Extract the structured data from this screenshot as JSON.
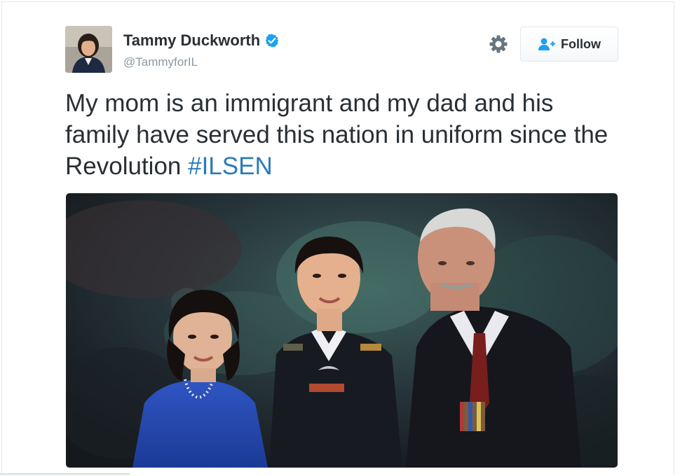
{
  "tweet": {
    "author": {
      "name": "Tammy Duckworth",
      "handle": "@TammyforIL",
      "verified": true,
      "verified_icon": "verified-badge-icon",
      "avatar_icon": "profile-avatar"
    },
    "actions": {
      "settings_icon": "gear-icon",
      "follow_label": "Follow",
      "follow_icon": "add-user-icon"
    },
    "text_parts": {
      "before": "My mom is an immigrant and my dad and his family have served this nation in uniform since the Revolution ",
      "hashtag": "#ILSEN"
    },
    "colors": {
      "text": "#292f33",
      "muted": "#8899a6",
      "link": "#2b7bb9",
      "verified": "#1da1f2",
      "border": "#e1e8ed"
    }
  }
}
